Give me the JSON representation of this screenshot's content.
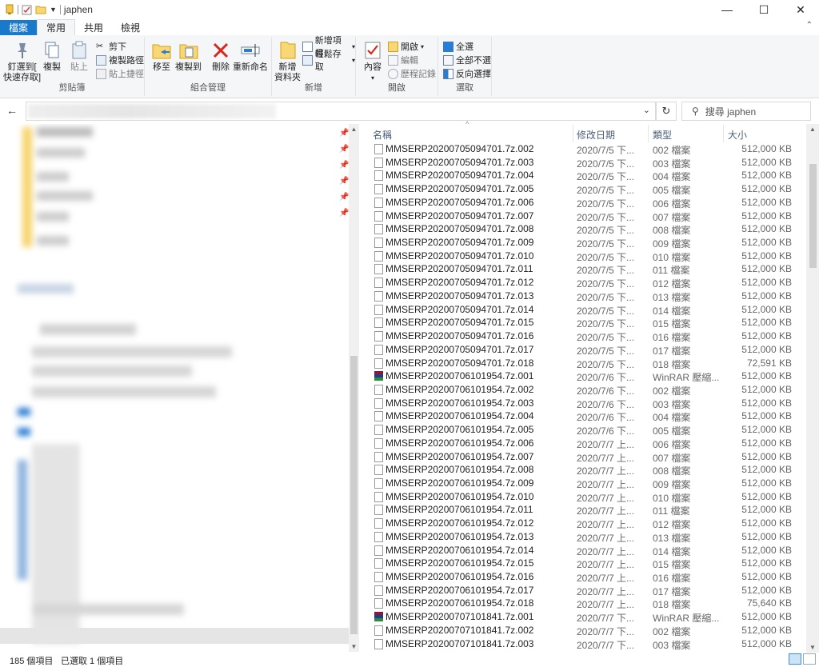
{
  "window": {
    "title": "japhen"
  },
  "ribbon_tabs": [
    "檔案",
    "常用",
    "共用",
    "檢視"
  ],
  "ribbon": {
    "clipboard": {
      "pin": "釘選到[\n快速存取]",
      "copy": "複製",
      "paste": "貼上",
      "cut": "剪下",
      "copy_path": "複製路徑",
      "paste_shortcut": "貼上捷徑",
      "label": "剪貼簿"
    },
    "organize": {
      "move_to": "移至",
      "copy_to": "複製到",
      "delete": "刪除",
      "rename": "重新命名",
      "label": "組合管理"
    },
    "new": {
      "new_folder": "新增\n資料夾",
      "new_item": "新增項目",
      "easy_access": "輕鬆存取",
      "label": "新增"
    },
    "open": {
      "properties": "內容",
      "open": "開啟",
      "edit": "編輯",
      "history": "歷程記錄",
      "label": "開啟"
    },
    "select": {
      "select_all": "全選",
      "select_none": "全部不選",
      "invert": "反向選擇",
      "label": "選取"
    }
  },
  "search": {
    "placeholder": "搜尋 japhen"
  },
  "columns": {
    "name": "名稱",
    "date": "修改日期",
    "type": "類型",
    "size": "大小"
  },
  "files": [
    {
      "name": "MMSERP20200705094701.7z.002",
      "date": "2020/7/5 下...",
      "type": "002 檔案",
      "size": "512,000 KB",
      "icon": "file"
    },
    {
      "name": "MMSERP20200705094701.7z.003",
      "date": "2020/7/5 下...",
      "type": "003 檔案",
      "size": "512,000 KB",
      "icon": "file"
    },
    {
      "name": "MMSERP20200705094701.7z.004",
      "date": "2020/7/5 下...",
      "type": "004 檔案",
      "size": "512,000 KB",
      "icon": "file"
    },
    {
      "name": "MMSERP20200705094701.7z.005",
      "date": "2020/7/5 下...",
      "type": "005 檔案",
      "size": "512,000 KB",
      "icon": "file"
    },
    {
      "name": "MMSERP20200705094701.7z.006",
      "date": "2020/7/5 下...",
      "type": "006 檔案",
      "size": "512,000 KB",
      "icon": "file"
    },
    {
      "name": "MMSERP20200705094701.7z.007",
      "date": "2020/7/5 下...",
      "type": "007 檔案",
      "size": "512,000 KB",
      "icon": "file"
    },
    {
      "name": "MMSERP20200705094701.7z.008",
      "date": "2020/7/5 下...",
      "type": "008 檔案",
      "size": "512,000 KB",
      "icon": "file"
    },
    {
      "name": "MMSERP20200705094701.7z.009",
      "date": "2020/7/5 下...",
      "type": "009 檔案",
      "size": "512,000 KB",
      "icon": "file"
    },
    {
      "name": "MMSERP20200705094701.7z.010",
      "date": "2020/7/5 下...",
      "type": "010 檔案",
      "size": "512,000 KB",
      "icon": "file"
    },
    {
      "name": "MMSERP20200705094701.7z.011",
      "date": "2020/7/5 下...",
      "type": "011 檔案",
      "size": "512,000 KB",
      "icon": "file"
    },
    {
      "name": "MMSERP20200705094701.7z.012",
      "date": "2020/7/5 下...",
      "type": "012 檔案",
      "size": "512,000 KB",
      "icon": "file"
    },
    {
      "name": "MMSERP20200705094701.7z.013",
      "date": "2020/7/5 下...",
      "type": "013 檔案",
      "size": "512,000 KB",
      "icon": "file"
    },
    {
      "name": "MMSERP20200705094701.7z.014",
      "date": "2020/7/5 下...",
      "type": "014 檔案",
      "size": "512,000 KB",
      "icon": "file"
    },
    {
      "name": "MMSERP20200705094701.7z.015",
      "date": "2020/7/5 下...",
      "type": "015 檔案",
      "size": "512,000 KB",
      "icon": "file"
    },
    {
      "name": "MMSERP20200705094701.7z.016",
      "date": "2020/7/5 下...",
      "type": "016 檔案",
      "size": "512,000 KB",
      "icon": "file"
    },
    {
      "name": "MMSERP20200705094701.7z.017",
      "date": "2020/7/5 下...",
      "type": "017 檔案",
      "size": "512,000 KB",
      "icon": "file"
    },
    {
      "name": "MMSERP20200705094701.7z.018",
      "date": "2020/7/5 下...",
      "type": "018 檔案",
      "size": "72,591 KB",
      "icon": "file"
    },
    {
      "name": "MMSERP20200706101954.7z.001",
      "date": "2020/7/6 下...",
      "type": "WinRAR 壓縮...",
      "size": "512,000 KB",
      "icon": "rar"
    },
    {
      "name": "MMSERP20200706101954.7z.002",
      "date": "2020/7/6 下...",
      "type": "002 檔案",
      "size": "512,000 KB",
      "icon": "file"
    },
    {
      "name": "MMSERP20200706101954.7z.003",
      "date": "2020/7/6 下...",
      "type": "003 檔案",
      "size": "512,000 KB",
      "icon": "file"
    },
    {
      "name": "MMSERP20200706101954.7z.004",
      "date": "2020/7/6 下...",
      "type": "004 檔案",
      "size": "512,000 KB",
      "icon": "file"
    },
    {
      "name": "MMSERP20200706101954.7z.005",
      "date": "2020/7/6 下...",
      "type": "005 檔案",
      "size": "512,000 KB",
      "icon": "file"
    },
    {
      "name": "MMSERP20200706101954.7z.006",
      "date": "2020/7/7 上...",
      "type": "006 檔案",
      "size": "512,000 KB",
      "icon": "file"
    },
    {
      "name": "MMSERP20200706101954.7z.007",
      "date": "2020/7/7 上...",
      "type": "007 檔案",
      "size": "512,000 KB",
      "icon": "file"
    },
    {
      "name": "MMSERP20200706101954.7z.008",
      "date": "2020/7/7 上...",
      "type": "008 檔案",
      "size": "512,000 KB",
      "icon": "file"
    },
    {
      "name": "MMSERP20200706101954.7z.009",
      "date": "2020/7/7 上...",
      "type": "009 檔案",
      "size": "512,000 KB",
      "icon": "file"
    },
    {
      "name": "MMSERP20200706101954.7z.010",
      "date": "2020/7/7 上...",
      "type": "010 檔案",
      "size": "512,000 KB",
      "icon": "file"
    },
    {
      "name": "MMSERP20200706101954.7z.011",
      "date": "2020/7/7 上...",
      "type": "011 檔案",
      "size": "512,000 KB",
      "icon": "file"
    },
    {
      "name": "MMSERP20200706101954.7z.012",
      "date": "2020/7/7 上...",
      "type": "012 檔案",
      "size": "512,000 KB",
      "icon": "file"
    },
    {
      "name": "MMSERP20200706101954.7z.013",
      "date": "2020/7/7 上...",
      "type": "013 檔案",
      "size": "512,000 KB",
      "icon": "file"
    },
    {
      "name": "MMSERP20200706101954.7z.014",
      "date": "2020/7/7 上...",
      "type": "014 檔案",
      "size": "512,000 KB",
      "icon": "file"
    },
    {
      "name": "MMSERP20200706101954.7z.015",
      "date": "2020/7/7 上...",
      "type": "015 檔案",
      "size": "512,000 KB",
      "icon": "file"
    },
    {
      "name": "MMSERP20200706101954.7z.016",
      "date": "2020/7/7 上...",
      "type": "016 檔案",
      "size": "512,000 KB",
      "icon": "file"
    },
    {
      "name": "MMSERP20200706101954.7z.017",
      "date": "2020/7/7 上...",
      "type": "017 檔案",
      "size": "512,000 KB",
      "icon": "file"
    },
    {
      "name": "MMSERP20200706101954.7z.018",
      "date": "2020/7/7 上...",
      "type": "018 檔案",
      "size": "75,640 KB",
      "icon": "file"
    },
    {
      "name": "MMSERP20200707101841.7z.001",
      "date": "2020/7/7 下...",
      "type": "WinRAR 壓縮...",
      "size": "512,000 KB",
      "icon": "rar"
    },
    {
      "name": "MMSERP20200707101841.7z.002",
      "date": "2020/7/7 下...",
      "type": "002 檔案",
      "size": "512,000 KB",
      "icon": "file"
    },
    {
      "name": "MMSERP20200707101841.7z.003",
      "date": "2020/7/7 下...",
      "type": "003 檔案",
      "size": "512,000 KB",
      "icon": "file"
    }
  ],
  "status": {
    "count": "185 個項目",
    "selected": "已選取 1 個項目"
  }
}
